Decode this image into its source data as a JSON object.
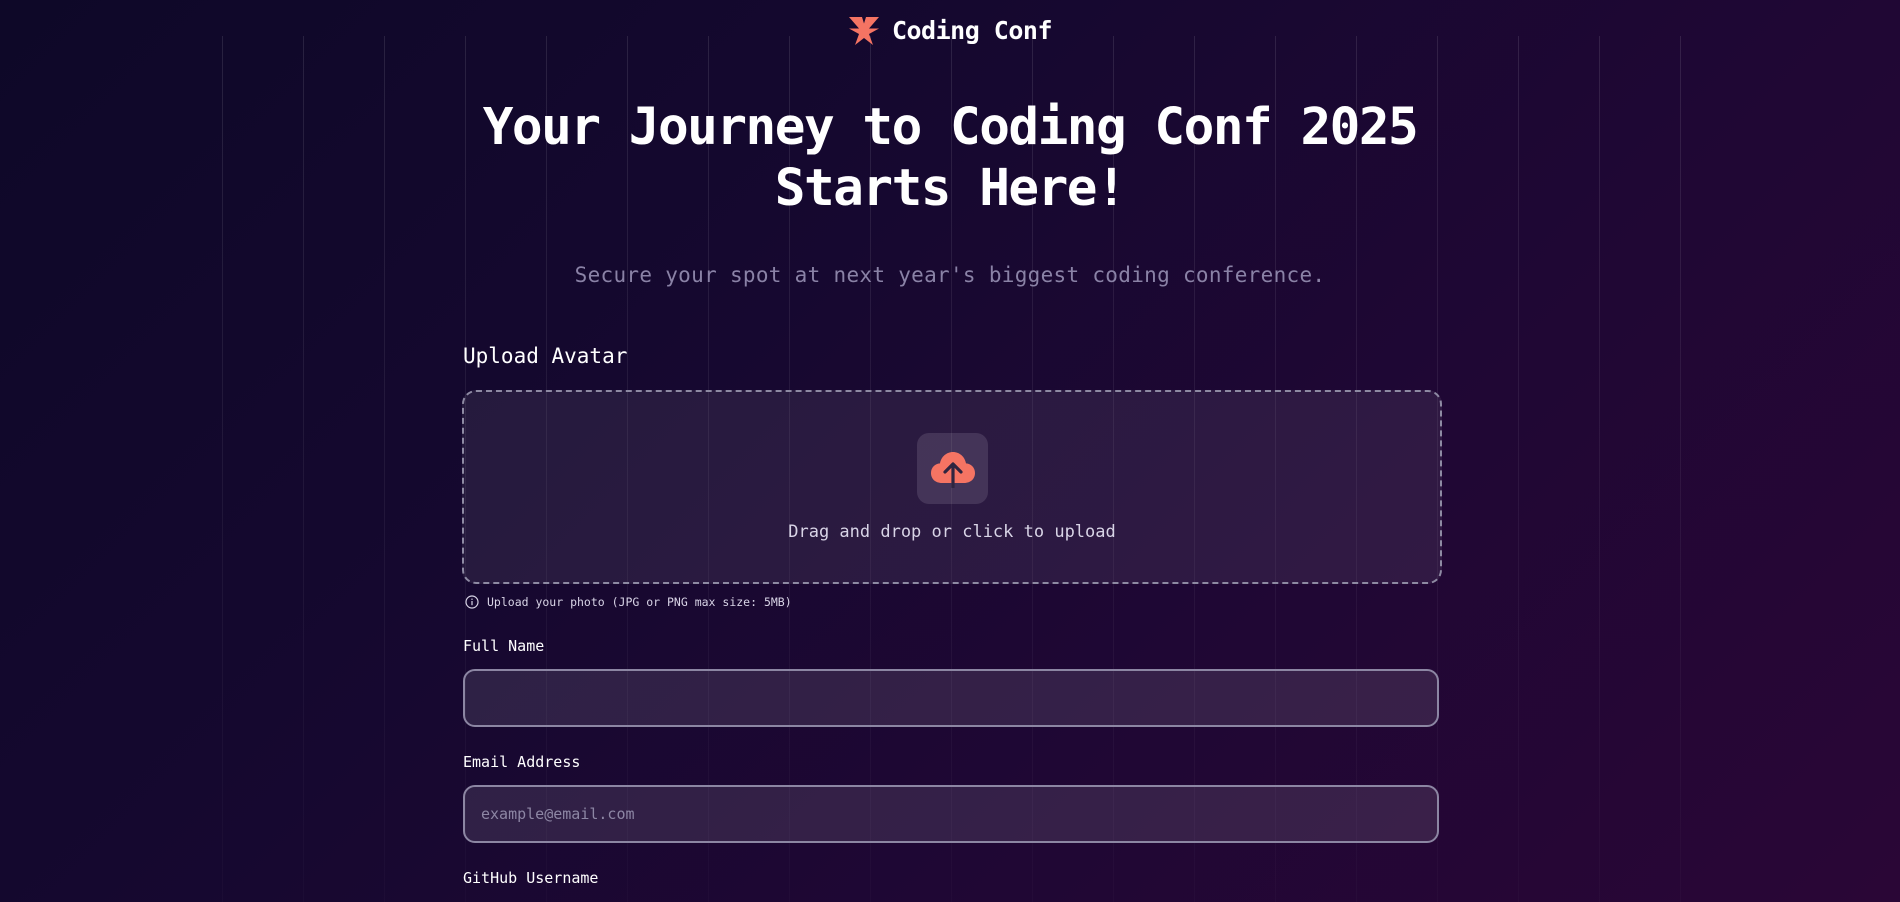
{
  "header": {
    "brand_name": "Coding Conf",
    "logo_icon": "coding-conf-logo-icon",
    "accent_color": "#f57463"
  },
  "hero": {
    "title": "Your Journey to Coding Conf 2025 Starts Here!",
    "subtitle": "Secure your spot at next year's biggest coding conference."
  },
  "form": {
    "avatar": {
      "label": "Upload Avatar",
      "drop_text": "Drag and drop or click to upload",
      "icon": "upload-cloud-icon",
      "hint_icon": "info-icon",
      "hint": "Upload your photo (JPG or PNG max size: 5MB)"
    },
    "full_name": {
      "label": "Full Name",
      "value": "",
      "placeholder": ""
    },
    "email": {
      "label": "Email Address",
      "value": "",
      "placeholder": "example@email.com"
    },
    "github": {
      "label": "GitHub Username"
    }
  }
}
